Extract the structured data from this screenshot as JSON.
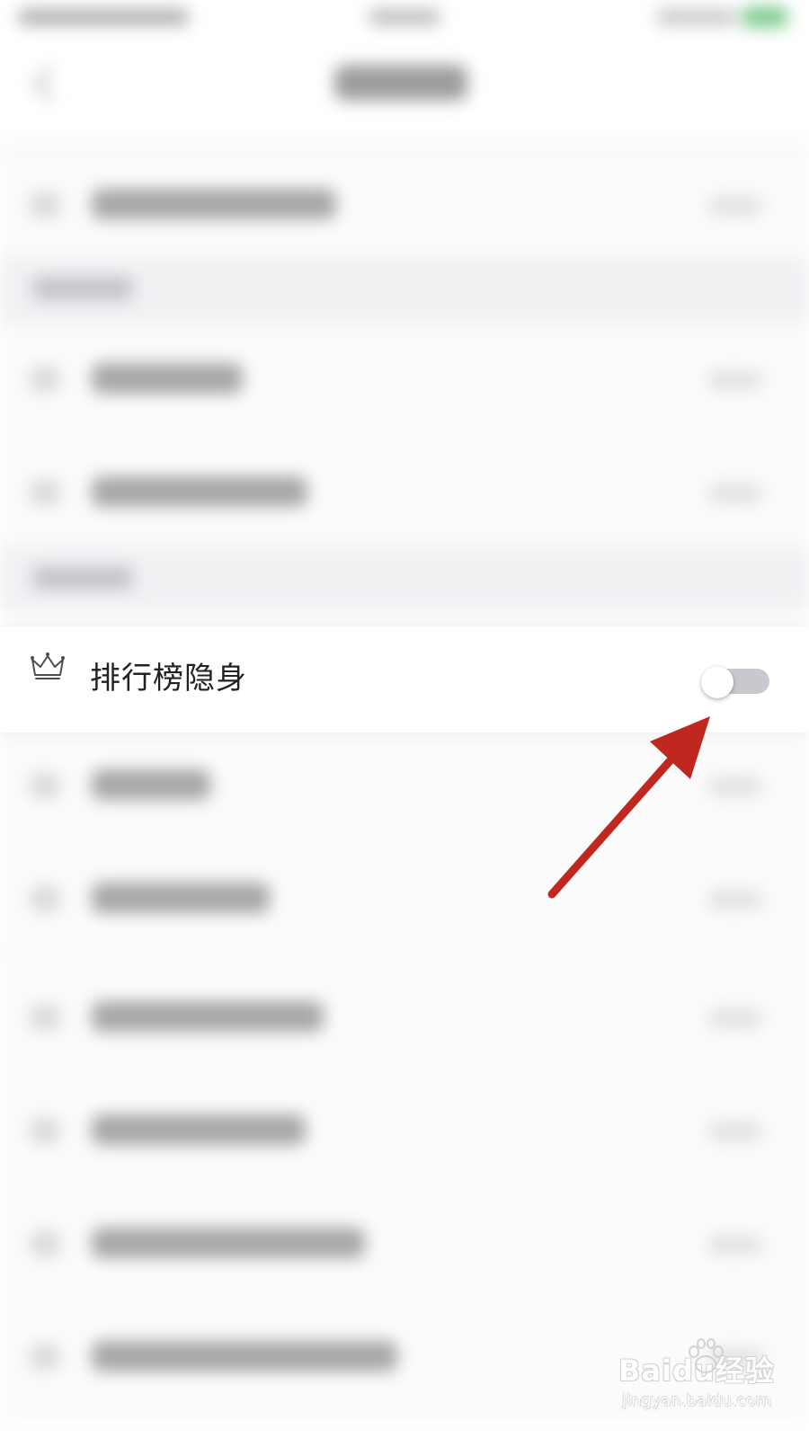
{
  "privacy_row": {
    "label": "排行榜隐身",
    "icon": "crown-icon",
    "toggle_on": false
  },
  "colors": {
    "annotation_arrow": "#c0271f",
    "toggle_track_off": "#c8c8ce",
    "background": "#ffffff"
  },
  "watermark": {
    "brand": "Baidu经验",
    "url": "jingyan.baidu.com"
  }
}
